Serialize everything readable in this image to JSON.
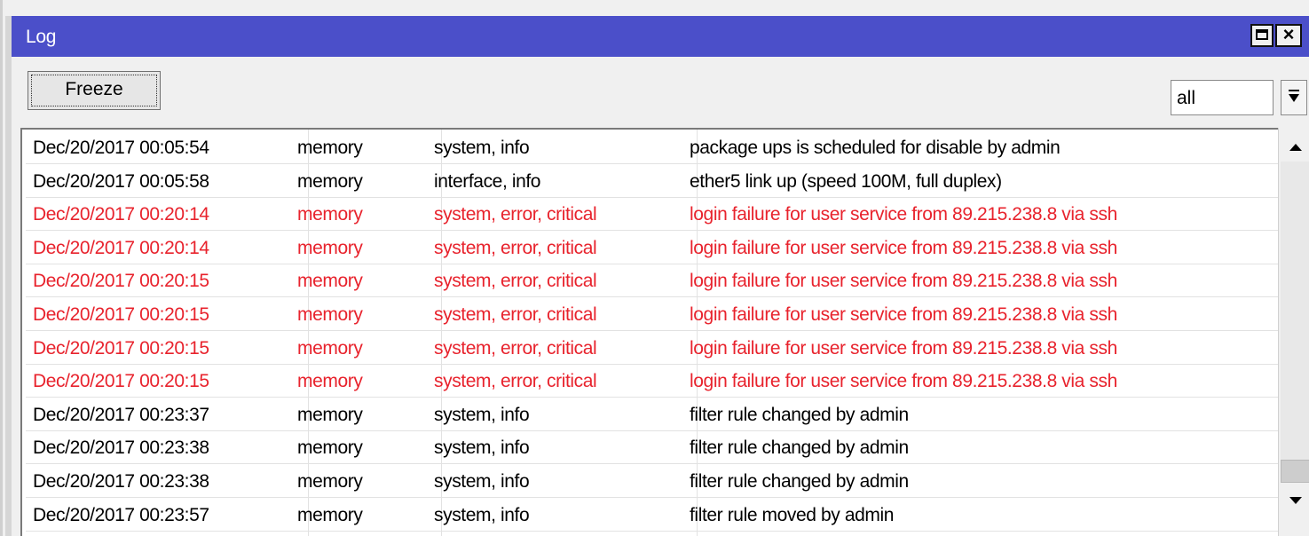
{
  "window": {
    "title": "Log"
  },
  "toolbar": {
    "freeze_label": "Freeze",
    "filter_value": "all"
  },
  "colors": {
    "titlebar": "#4b4fc9",
    "error_text": "#e8232d",
    "normal_text": "#000000"
  },
  "log": {
    "rows": [
      {
        "time": "Dec/20/2017 00:05:54",
        "buffer": "memory",
        "topics": "system, info",
        "message": "package ups is scheduled for disable by admin",
        "severity": "normal"
      },
      {
        "time": "Dec/20/2017 00:05:58",
        "buffer": "memory",
        "topics": "interface, info",
        "message": "ether5 link up (speed 100M, full duplex)",
        "severity": "normal"
      },
      {
        "time": "Dec/20/2017 00:20:14",
        "buffer": "memory",
        "topics": "system, error, critical",
        "message": "login failure for user service from 89.215.238.8 via ssh",
        "severity": "error"
      },
      {
        "time": "Dec/20/2017 00:20:14",
        "buffer": "memory",
        "topics": "system, error, critical",
        "message": "login failure for user service from 89.215.238.8 via ssh",
        "severity": "error"
      },
      {
        "time": "Dec/20/2017 00:20:15",
        "buffer": "memory",
        "topics": "system, error, critical",
        "message": "login failure for user service from 89.215.238.8 via ssh",
        "severity": "error"
      },
      {
        "time": "Dec/20/2017 00:20:15",
        "buffer": "memory",
        "topics": "system, error, critical",
        "message": "login failure for user service from 89.215.238.8 via ssh",
        "severity": "error"
      },
      {
        "time": "Dec/20/2017 00:20:15",
        "buffer": "memory",
        "topics": "system, error, critical",
        "message": "login failure for user service from 89.215.238.8 via ssh",
        "severity": "error"
      },
      {
        "time": "Dec/20/2017 00:20:15",
        "buffer": "memory",
        "topics": "system, error, critical",
        "message": "login failure for user service from 89.215.238.8 via ssh",
        "severity": "error"
      },
      {
        "time": "Dec/20/2017 00:23:37",
        "buffer": "memory",
        "topics": "system, info",
        "message": "filter rule changed by admin",
        "severity": "normal"
      },
      {
        "time": "Dec/20/2017 00:23:38",
        "buffer": "memory",
        "topics": "system, info",
        "message": "filter rule changed by admin",
        "severity": "normal"
      },
      {
        "time": "Dec/20/2017 00:23:38",
        "buffer": "memory",
        "topics": "system, info",
        "message": "filter rule changed by admin",
        "severity": "normal"
      },
      {
        "time": "Dec/20/2017 00:23:57",
        "buffer": "memory",
        "topics": "system, info",
        "message": "filter rule moved by admin",
        "severity": "normal"
      }
    ]
  },
  "icons": {
    "maximize": "maximize-icon",
    "close": "close-icon",
    "filter_dropdown": "dropdown-arrow-icon",
    "scroll_up": "scroll-up-arrow-icon",
    "scroll_down": "scroll-down-arrow-icon"
  }
}
